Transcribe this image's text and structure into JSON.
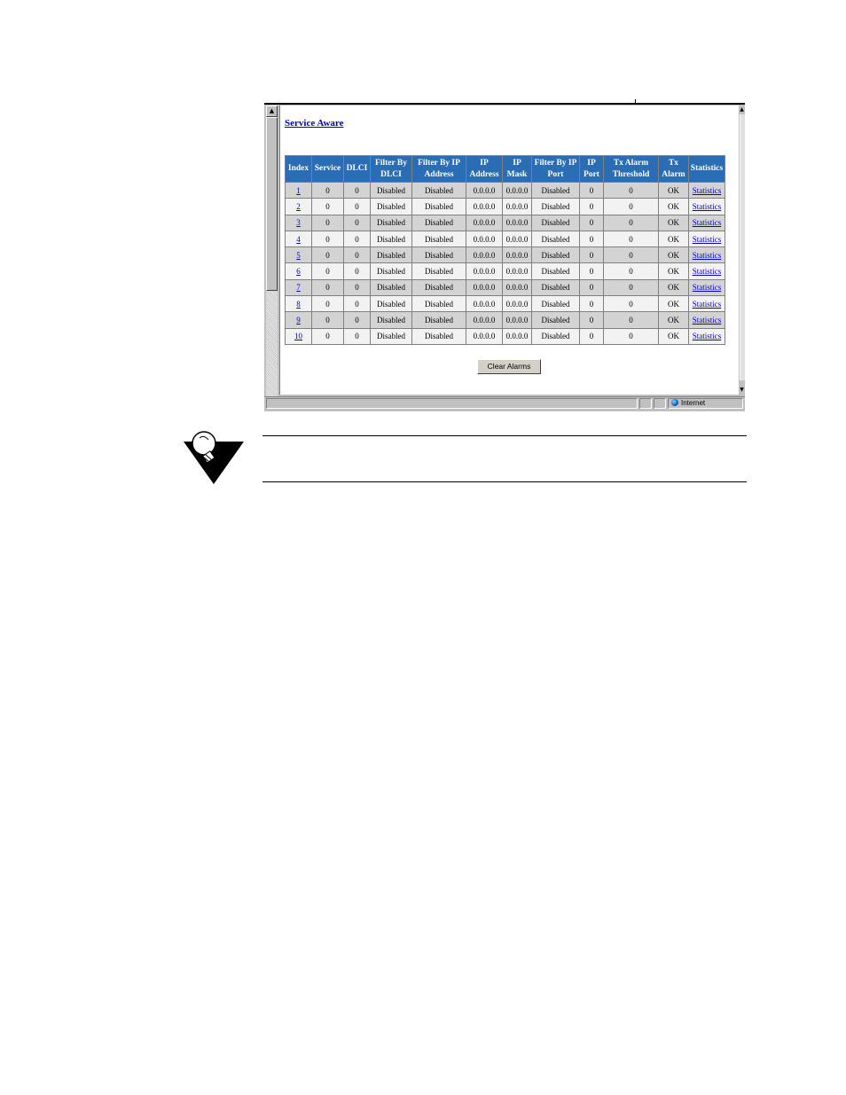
{
  "page": {
    "title_link": "Service Aware",
    "clear_button": "Clear Alarms"
  },
  "table": {
    "headers": [
      "Index",
      "Service",
      "DLCI",
      "Filter By DLCI",
      "Filter By IP Address",
      "IP Address",
      "IP Mask",
      "Filter By IP Port",
      "IP Port",
      "Tx Alarm Threshold",
      "Tx Alarm",
      "Statistics"
    ],
    "rows": [
      {
        "index": "1",
        "service": "0",
        "dlci": "0",
        "filter_dlci": "Disabled",
        "filter_ip": "Disabled",
        "ip_address": "0.0.0.0",
        "ip_mask": "0.0.0.0",
        "filter_port": "Disabled",
        "ip_port": "0",
        "threshold": "0",
        "tx_alarm": "OK",
        "statistics": "Statistics"
      },
      {
        "index": "2",
        "service": "0",
        "dlci": "0",
        "filter_dlci": "Disabled",
        "filter_ip": "Disabled",
        "ip_address": "0.0.0.0",
        "ip_mask": "0.0.0.0",
        "filter_port": "Disabled",
        "ip_port": "0",
        "threshold": "0",
        "tx_alarm": "OK",
        "statistics": "Statistics"
      },
      {
        "index": "3",
        "service": "0",
        "dlci": "0",
        "filter_dlci": "Disabled",
        "filter_ip": "Disabled",
        "ip_address": "0.0.0.0",
        "ip_mask": "0.0.0.0",
        "filter_port": "Disabled",
        "ip_port": "0",
        "threshold": "0",
        "tx_alarm": "OK",
        "statistics": "Statistics"
      },
      {
        "index": "4",
        "service": "0",
        "dlci": "0",
        "filter_dlci": "Disabled",
        "filter_ip": "Disabled",
        "ip_address": "0.0.0.0",
        "ip_mask": "0.0.0.0",
        "filter_port": "Disabled",
        "ip_port": "0",
        "threshold": "0",
        "tx_alarm": "OK",
        "statistics": "Statistics"
      },
      {
        "index": "5",
        "service": "0",
        "dlci": "0",
        "filter_dlci": "Disabled",
        "filter_ip": "Disabled",
        "ip_address": "0.0.0.0",
        "ip_mask": "0.0.0.0",
        "filter_port": "Disabled",
        "ip_port": "0",
        "threshold": "0",
        "tx_alarm": "OK",
        "statistics": "Statistics"
      },
      {
        "index": "6",
        "service": "0",
        "dlci": "0",
        "filter_dlci": "Disabled",
        "filter_ip": "Disabled",
        "ip_address": "0.0.0.0",
        "ip_mask": "0.0.0.0",
        "filter_port": "Disabled",
        "ip_port": "0",
        "threshold": "0",
        "tx_alarm": "OK",
        "statistics": "Statistics"
      },
      {
        "index": "7",
        "service": "0",
        "dlci": "0",
        "filter_dlci": "Disabled",
        "filter_ip": "Disabled",
        "ip_address": "0.0.0.0",
        "ip_mask": "0.0.0.0",
        "filter_port": "Disabled",
        "ip_port": "0",
        "threshold": "0",
        "tx_alarm": "OK",
        "statistics": "Statistics"
      },
      {
        "index": "8",
        "service": "0",
        "dlci": "0",
        "filter_dlci": "Disabled",
        "filter_ip": "Disabled",
        "ip_address": "0.0.0.0",
        "ip_mask": "0.0.0.0",
        "filter_port": "Disabled",
        "ip_port": "0",
        "threshold": "0",
        "tx_alarm": "OK",
        "statistics": "Statistics"
      },
      {
        "index": "9",
        "service": "0",
        "dlci": "0",
        "filter_dlci": "Disabled",
        "filter_ip": "Disabled",
        "ip_address": "0.0.0.0",
        "ip_mask": "0.0.0.0",
        "filter_port": "Disabled",
        "ip_port": "0",
        "threshold": "0",
        "tx_alarm": "OK",
        "statistics": "Statistics"
      },
      {
        "index": "10",
        "service": "0",
        "dlci": "0",
        "filter_dlci": "Disabled",
        "filter_ip": "Disabled",
        "ip_address": "0.0.0.0",
        "ip_mask": "0.0.0.0",
        "filter_port": "Disabled",
        "ip_port": "0",
        "threshold": "0",
        "tx_alarm": "OK",
        "statistics": "Statistics"
      }
    ]
  },
  "statusbar": {
    "zone_label": "Internet",
    "zone_icon": "globe-icon"
  },
  "note": {
    "icon": "lightbulb-icon"
  },
  "colors": {
    "header_bg": "#2a6db5",
    "row_dark": "#d3d3d3",
    "row_light": "#f2f2f2",
    "link": "#0000cc"
  }
}
